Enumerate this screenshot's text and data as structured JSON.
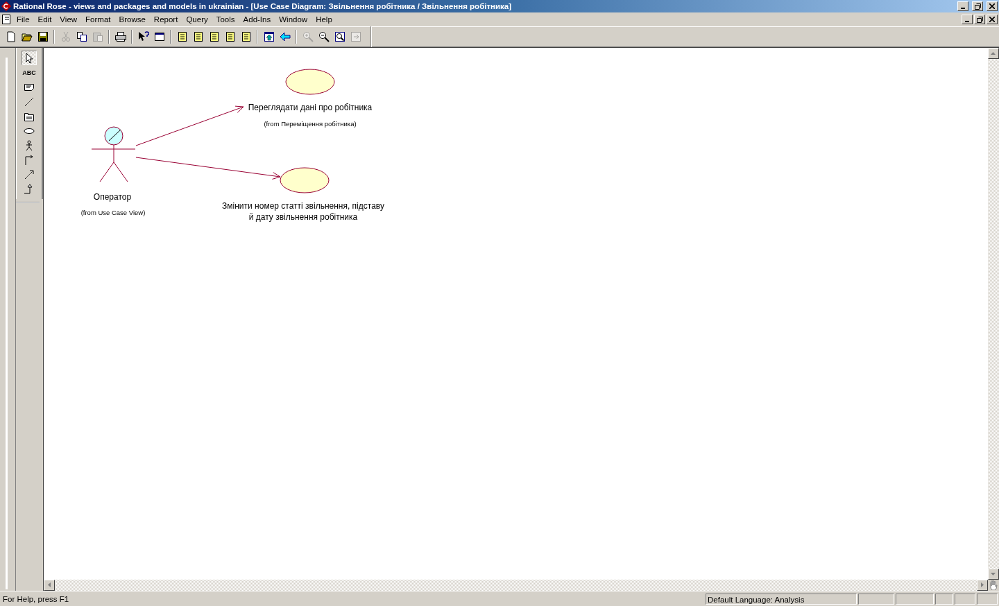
{
  "window": {
    "title": "Rational Rose - views and packages and models in ukrainian - [Use Case Diagram: Звільнення робітника / Звільнення робітника]"
  },
  "menu": [
    "File",
    "Edit",
    "View",
    "Format",
    "Browse",
    "Report",
    "Query",
    "Tools",
    "Add-Ins",
    "Window",
    "Help"
  ],
  "toolbar": [
    {
      "kind": "new",
      "disabled": false
    },
    {
      "kind": "open",
      "disabled": false
    },
    {
      "kind": "save",
      "disabled": false
    },
    {
      "kind": "separator"
    },
    {
      "kind": "cut",
      "disabled": true
    },
    {
      "kind": "copy",
      "disabled": false
    },
    {
      "kind": "paste",
      "disabled": true
    },
    {
      "kind": "separator"
    },
    {
      "kind": "print",
      "disabled": false
    },
    {
      "kind": "separator"
    },
    {
      "kind": "help",
      "disabled": false
    },
    {
      "kind": "browser",
      "disabled": false
    },
    {
      "kind": "separator"
    },
    {
      "kind": "page",
      "disabled": false
    },
    {
      "kind": "page",
      "disabled": false
    },
    {
      "kind": "page",
      "disabled": false
    },
    {
      "kind": "page",
      "disabled": false
    },
    {
      "kind": "page",
      "disabled": false
    },
    {
      "kind": "separator"
    },
    {
      "kind": "up",
      "disabled": false
    },
    {
      "kind": "back",
      "disabled": false
    },
    {
      "kind": "separator"
    },
    {
      "kind": "zoomin",
      "disabled": true
    },
    {
      "kind": "zoomout",
      "disabled": false
    },
    {
      "kind": "fit",
      "disabled": false
    },
    {
      "kind": "undofit",
      "disabled": true
    }
  ],
  "toolbox": [
    {
      "kind": "pointer",
      "selected": true
    },
    {
      "kind": "text",
      "label": "ABC",
      "selected": false
    },
    {
      "kind": "note",
      "selected": false
    },
    {
      "kind": "anchor",
      "selected": false
    },
    {
      "kind": "package",
      "selected": false
    },
    {
      "kind": "usecase",
      "selected": false
    },
    {
      "kind": "actor",
      "selected": false
    },
    {
      "kind": "association",
      "selected": false
    },
    {
      "kind": "dependency",
      "selected": false
    },
    {
      "kind": "generalization",
      "selected": false
    }
  ],
  "diagram": {
    "actors": [
      {
        "name": "Оператор",
        "from": "(from Use Case View)"
      }
    ],
    "use_cases": [
      {
        "name_lines": [
          "Переглядати дані про робітника"
        ],
        "from": "(from Переміщення робітника)"
      },
      {
        "name_lines": [
          "Змінити номер статті звільнення, підставу",
          "й дату звільнення робітника"
        ]
      }
    ]
  },
  "status_bar": {
    "help": "For Help, press F1",
    "language": "Default Language: Analysis"
  }
}
